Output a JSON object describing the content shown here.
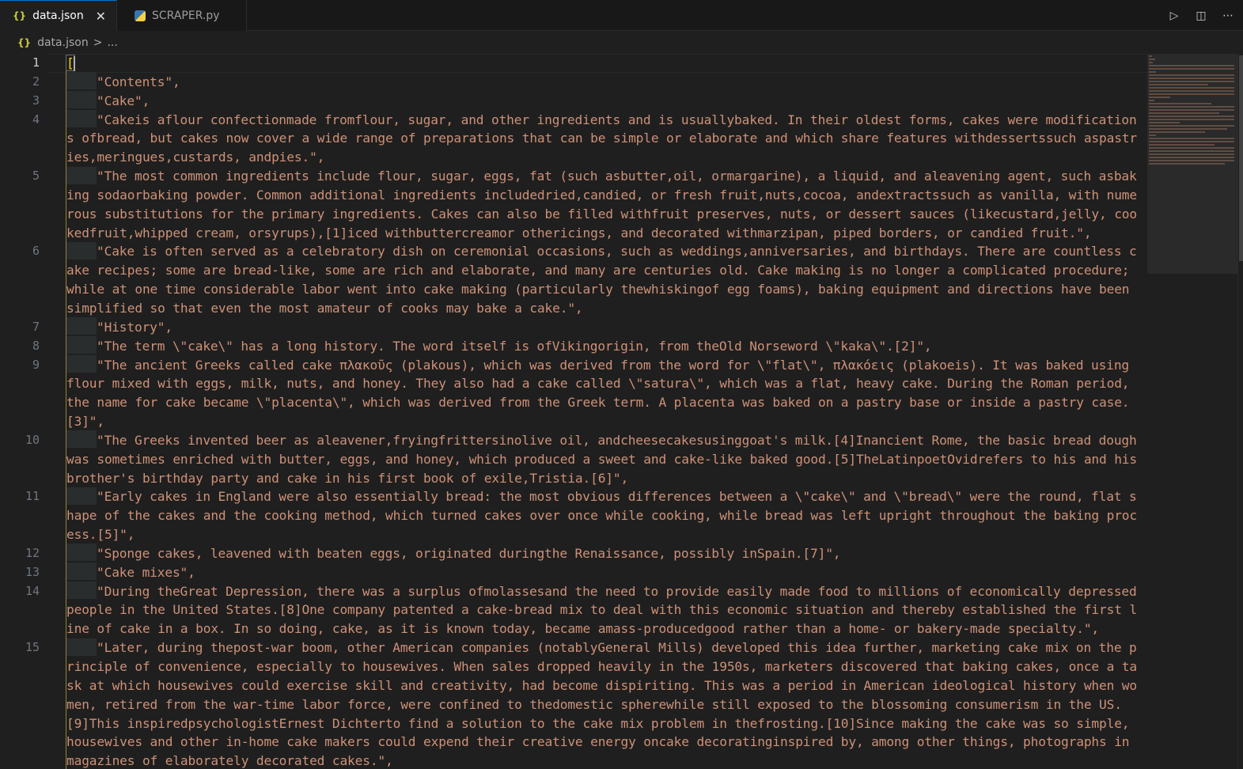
{
  "tabs": [
    {
      "label": "data.json",
      "icon": "json-braces-icon",
      "active": true
    },
    {
      "label": "SCRAPER.py",
      "icon": "python-icon",
      "active": false
    }
  ],
  "tab_close_glyph": "✕",
  "actions": {
    "run": "▷",
    "split": "◫",
    "more": "⋯"
  },
  "breadcrumb": {
    "file": "data.json",
    "separator": ">",
    "more": "..."
  },
  "json_icon_glyph": "{}",
  "editor": {
    "lines": [
      {
        "n": "1",
        "text": "["
      },
      {
        "n": "2",
        "text": "\"Contents\","
      },
      {
        "n": "3",
        "text": "\"Cake\","
      },
      {
        "n": "4",
        "text": "\"Cakeis aflour confectionmade fromflour, sugar, and other ingredients and is usuallybaked. In their oldest forms, cakes were modifications ofbread, but cakes now cover a wide range of preparations that can be simple or elaborate and which share features withdessertssuch aspastries,meringues,custards, andpies.\","
      },
      {
        "n": "5",
        "text": "\"The most common ingredients include flour, sugar, eggs, fat (such asbutter,oil, ormargarine), a liquid, and aleavening agent, such asbaking sodaorbaking powder. Common additional ingredients includedried,candied, or fresh fruit,nuts,cocoa, andextractssuch as vanilla, with numerous substitutions for the primary ingredients. Cakes can also be filled withfruit preserves, nuts, or dessert sauces (likecustard,jelly, cookedfruit,whipped cream, orsyrups),[1]iced withbuttercreamor othericings, and decorated withmarzipan, piped borders, or candied fruit.\","
      },
      {
        "n": "6",
        "text": "\"Cake is often served as a celebratory dish on ceremonial occasions, such as weddings,anniversaries, and birthdays. There are countless cake recipes; some are bread-like, some are rich and elaborate, and many are centuries old. Cake making is no longer a complicated procedure; while at one time considerable labor went into cake making (particularly thewhiskingof egg foams), baking equipment and directions have been simplified so that even the most amateur of cooks may bake a cake.\","
      },
      {
        "n": "7",
        "text": "\"History\","
      },
      {
        "n": "8",
        "text": "\"The term \\\"cake\\\" has a long history. The word itself is ofVikingorigin, from theOld Norseword \\\"kaka\\\".[2]\","
      },
      {
        "n": "9",
        "text": "\"The ancient Greeks called cake πλακοῦς (plakous), which was derived from the word for \\\"flat\\\", πλακόεις (plakoeis). It was baked using flour mixed with eggs, milk, nuts, and honey. They also had a cake called \\\"satura\\\", which was a flat, heavy cake. During the Roman period, the name for cake became \\\"placenta\\\", which was derived from the Greek term. A placenta was baked on a pastry base or inside a pastry case.[3]\","
      },
      {
        "n": "10",
        "text": "\"The Greeks invented beer as aleavener,fryingfrittersinolive oil, andcheesecakesusinggoat's milk.[4]Inancient Rome, the basic bread dough was sometimes enriched with butter, eggs, and honey, which produced a sweet and cake-like baked good.[5]TheLatinpoetOvidrefers to his and his brother's birthday party and cake in his first book of exile,Tristia.[6]\","
      },
      {
        "n": "11",
        "text": "\"Early cakes in England were also essentially bread: the most obvious differences between a \\\"cake\\\" and \\\"bread\\\" were the round, flat shape of the cakes and the cooking method, which turned cakes over once while cooking, while bread was left upright throughout the baking process.[5]\","
      },
      {
        "n": "12",
        "text": "\"Sponge cakes, leavened with beaten eggs, originated duringthe Renaissance, possibly inSpain.[7]\","
      },
      {
        "n": "13",
        "text": "\"Cake mixes\","
      },
      {
        "n": "14",
        "text": "\"During theGreat Depression, there was a surplus ofmolassesand the need to provide easily made food to millions of economically depressed people in the United States.[8]One company patented a cake-bread mix to deal with this economic situation and thereby established the first line of cake in a box. In so doing, cake, as it is known today, became amass-producedgood rather than a home- or bakery-made specialty.\","
      },
      {
        "n": "15",
        "text": "\"Later, during thepost-war boom, other American companies (notablyGeneral Mills) developed this idea further, marketing cake mix on the principle of convenience, especially to housewives. When sales dropped heavily in the 1950s, marketers discovered that baking cakes, once a task at which housewives could exercise skill and creativity, had become dispiriting. This was a period in American ideological history when women, retired from the war-time labor force, were confined to thedomestic spherewhile still exposed to the blossoming consumerism in the US.[9]This inspiredpsychologistErnest Dichterto find a solution to the cake mix problem in thefrosting.[10]Since making the cake was so simple, housewives and other in-home cake makers could expend their creative energy oncake decoratinginspired by, among other things, photographs in magazines of elaborately decorated cakes.\","
      }
    ]
  },
  "colors": {
    "string": "#ce9178",
    "bracket": "#ffd700",
    "accent": "#0078d4",
    "line_number": "#6e7681"
  }
}
